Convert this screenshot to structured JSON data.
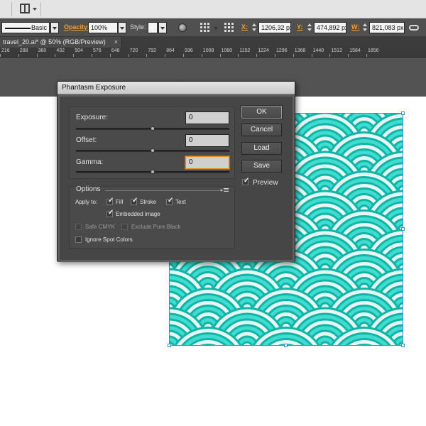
{
  "app": {
    "stroke_style_label": "Basic",
    "opacity_label": "Opacity:",
    "opacity_value": "100%",
    "style_label": "Style:",
    "x_label": "X:",
    "x_value": "1206,32 px",
    "y_label": "Y:",
    "y_value": "474,892 px",
    "w_label": "W:",
    "w_value": "821,083 px",
    "document_tab": "travel_20.ai* @ 50% (RGB/Preview)",
    "document_tab_close": "×"
  },
  "ruler": {
    "ticks": [
      "216",
      "288",
      "360",
      "432",
      "504",
      "576",
      "648",
      "720",
      "792",
      "864",
      "936",
      "1008",
      "1080",
      "1152",
      "1224",
      "1296",
      "1368",
      "1440",
      "1512",
      "1584",
      "1656"
    ]
  },
  "dialog": {
    "title": "Phantasm Exposure",
    "exposure_label": "Exposure:",
    "exposure_value": "0",
    "exposure_level": 0.5,
    "offset_label": "Offset:",
    "offset_value": "0",
    "offset_level": 0.5,
    "gamma_label": "Gamma:",
    "gamma_value": "0",
    "gamma_level": 0.5,
    "options_title": "Options",
    "apply_to_label": "Apply to:",
    "fill_label": "Fill",
    "stroke_label": "Stroke",
    "text_label": "Text",
    "embedded_image_label": "Embedded image",
    "safe_cmyk_label": "Safe CMYK",
    "exclude_pure_black_label": "Exclude Pure Black",
    "ignore_spot_colors_label": "Ignore Spot Colors",
    "ok_label": "OK",
    "cancel_label": "Cancel",
    "load_label": "Load",
    "save_label": "Save",
    "preview_label": "Preview",
    "checkmark": "✓"
  },
  "colors": {
    "pattern_base": "#3fdcd0",
    "pattern_stroke": "#11b5a8",
    "pattern_light": "#e6f7f4",
    "selection": "#3b8bd8",
    "accent_orange": "#f0a030"
  }
}
